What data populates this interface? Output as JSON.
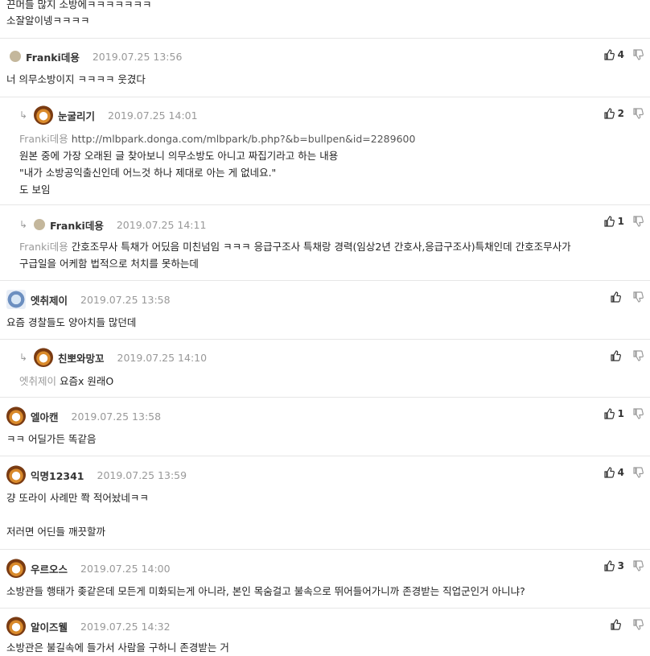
{
  "top": [
    "끈머들 많지 소방에ㅋㅋㅋㅋㅋㅋㅋ",
    "소잘알이넹ㅋㅋㅋㅋ"
  ],
  "comments": [
    {
      "nick": "Franki데용",
      "date": "2019.07.25 13:56",
      "votes": "4",
      "lines": [
        "너 의무소방이지 ㅋㅋㅋㅋ 웃겼다"
      ]
    },
    {
      "nick": "눈굴리기",
      "date": "2019.07.25 14:01",
      "votes": "2",
      "tag": "Franki데용",
      "link": "http://mlbpark.donga.com/mlbpark/b.php?&b=bullpen&id=2289600",
      "lines": [
        "원본 중에 가장 오래된 글 찾아보니 의무소방도 아니고 짜집기라고 하는 내용",
        "\"내가 소방공익출신인데 어느것 하나 제대로 아는 게 없네요.\"",
        "도 보임"
      ]
    },
    {
      "nick": "Franki데용",
      "date": "2019.07.25 14:11",
      "votes": "1",
      "tag": "Franki데용",
      "lines": [
        "간호조무사 특채가 어딨음 미친넘임 ㅋㅋㅋ 응급구조사 특채랑 경력(임상2년 간호사,응급구조사)특채인데 간호조무사가",
        "구급일을 어케함 법적으로 처치를 못하는데"
      ]
    },
    {
      "nick": "엣취제이",
      "date": "2019.07.25 13:58",
      "votes": "",
      "lines": [
        "요즘 경찰들도 양아치들 많던데"
      ]
    },
    {
      "nick": "친뽀와망꼬",
      "date": "2019.07.25 14:10",
      "votes": "",
      "tag": "엣취제이",
      "lines": [
        "요즘x 원래O"
      ]
    },
    {
      "nick": "엘아캔",
      "date": "2019.07.25 13:58",
      "votes": "1",
      "lines": [
        "ㅋㅋ 어딜가든 똑같음"
      ]
    },
    {
      "nick": "익명12341",
      "date": "2019.07.25 13:59",
      "votes": "4",
      "lines": [
        "걍 또라이 사례만 쫙 적어놨네ㅋㅋ",
        "",
        "저러면 어딘들 깨끗할까"
      ]
    },
    {
      "nick": "우르오스",
      "date": "2019.07.25 14:00",
      "votes": "3",
      "lines": [
        "소방관들 행태가 좆같은데 모든게 미화되는게 아니라, 본인 목숨걸고 불속으로 뛰어들어가니까 존경받는 직업군인거 아니냐?"
      ]
    },
    {
      "nick": "알이즈웰",
      "date": "2019.07.25 14:32",
      "votes": "",
      "lines": [
        "소방관은 불길속에 들가서 사람을 구하니 존경받는 거"
      ]
    }
  ]
}
